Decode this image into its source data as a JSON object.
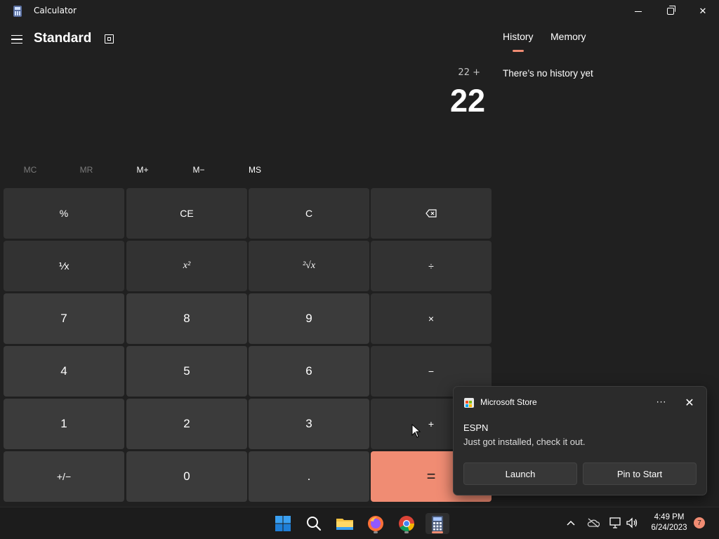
{
  "window": {
    "title": "Calculator",
    "controls": [
      "minimize",
      "maximize",
      "close"
    ]
  },
  "header": {
    "mode": "Standard",
    "menu_icon": "hamburger-icon",
    "keep_on_top_icon": "keep-on-top-icon"
  },
  "display": {
    "expression": "22 +",
    "value": "22"
  },
  "memory": {
    "mc": "MC",
    "mr": "MR",
    "mplus": "M+",
    "mminus": "M−",
    "ms": "MS"
  },
  "keys": {
    "percent": "%",
    "ce": "CE",
    "c": "C",
    "backspace": "⌫",
    "reciprocal": "⅟x",
    "square": "x²",
    "sqrt": "²√x",
    "divide": "÷",
    "seven": "7",
    "eight": "8",
    "nine": "9",
    "multiply": "×",
    "four": "4",
    "five": "5",
    "six": "6",
    "minus": "−",
    "one": "1",
    "two": "2",
    "three": "3",
    "plus": "+",
    "negate": "+/−",
    "zero": "0",
    "decimal": ".",
    "equals": "="
  },
  "side_panel": {
    "tabs": [
      "History",
      "Memory"
    ],
    "active_tab": "History",
    "empty_message": "There’s no history yet"
  },
  "toast": {
    "app": "Microsoft Store",
    "more": "···",
    "close": "✕",
    "title": "ESPN",
    "body": "Just got installed, check it out.",
    "buttons": [
      "Launch",
      "Pin to Start"
    ]
  },
  "taskbar": {
    "apps": [
      "start-icon",
      "search-icon",
      "file-explorer-icon",
      "firefox-icon",
      "chrome-icon",
      "calculator-icon"
    ],
    "time": "4:49 PM",
    "date": "6/24/2023",
    "notification_count": "7"
  },
  "colors": {
    "background": "#202020",
    "accent": "#f08c73",
    "key": "#3b3b3b",
    "function_key": "#323232"
  }
}
